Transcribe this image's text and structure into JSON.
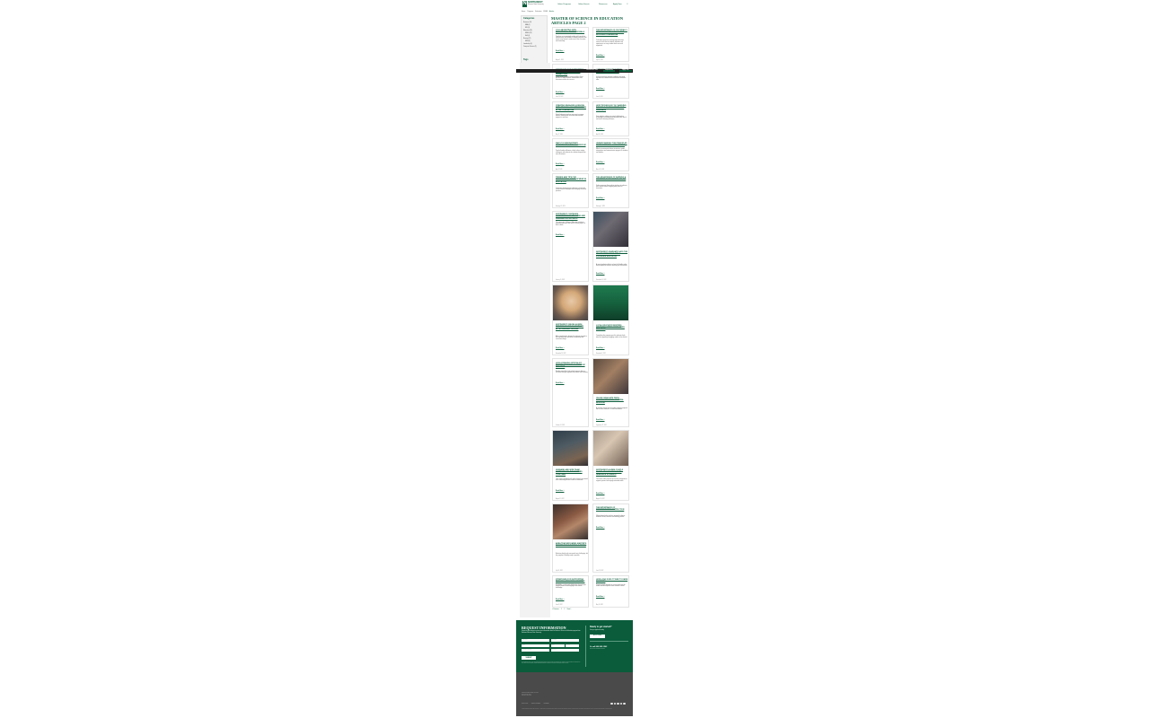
{
  "header": {
    "logo_mark": "N",
    "logo_name": "NORTHWEST",
    "logo_sub": "Missouri State University",
    "nav": [
      "Online Programs",
      "Online Events",
      "Resources",
      "Apply Now"
    ],
    "search_icon": "search-icon"
  },
  "breadcrumb": [
    "Home",
    "Programs",
    "Education",
    "MSED",
    "Articles"
  ],
  "sidebar": {
    "title": "Categories",
    "items": [
      "Business (10)",
      "MBA (5)",
      "MIS (3)",
      "Education (26)",
      "MSED (18)",
      "EdS (4)",
      "Nursing (12)",
      "MSN (8)",
      "Leadership (6)",
      "Computer Science (3)"
    ],
    "tags_title": "Tags"
  },
  "page_title": "Master of Science in Education Articles Page 2",
  "sticky": {
    "phone": "Call 660-562-1562",
    "request": "Request Info",
    "apply": "Apply Now"
  },
  "articles": [
    {
      "title": "Collaborating with Educational Professionals",
      "excerpt": "Teachers are increasingly working with specialists, administrators and families to design instruction that meets every learner's needs across the classroom and community.",
      "more": "Read More »",
      "date": "August 3, 2023"
    },
    {
      "title": "The Importance of Culturally Responsive Teaching in the Inclusive Classroom",
      "excerpt": "Culturally responsive teaching helps educators connect curriculum to students' identities and experiences so every student feels seen and supported.",
      "more": "Read More »",
      "date": "July 19, 2023"
    },
    {
      "title": "Strategies for Supporting Students With Learning Disabilities",
      "excerpt": "Understanding diverse learning profiles allows teachers to adapt lessons, assessments and classroom routines for success.",
      "more": "Read More »",
      "date": "June 28, 2023"
    },
    {
      "title": "How Inclusive Education Benefits All Learners",
      "excerpt": "Inclusive practices improve academic and social outcomes for students with and without disabilities alike.",
      "more": "Read More »",
      "date": "June 8, 2023"
    },
    {
      "title": "Creating Engaging Lessons With Technology Integration in the Classroom",
      "excerpt": "Digital tools give teachers new ways to engage learners, differentiate instruction and measure progress in real time.",
      "more": "Read More »",
      "date": "May 17, 2023"
    },
    {
      "title": "How Technology Is Changing the Role of Educators and Learners",
      "excerpt": "From adaptive software to virtual collaboration, technology is reshaping how educators plan, teach and assess learning outcomes.",
      "more": "Read More »",
      "date": "April 26, 2023"
    },
    {
      "title": "Ways to Demonstrate Leadership in the Classroom",
      "excerpt": "Teacher leaders influence school culture, mentor colleagues and advocate for students beyond their own classrooms.",
      "more": "Read More »",
      "date": "April 5, 2023"
    },
    {
      "title": "Understanding the Principles of Educational Assessment",
      "excerpt": "Effective assessment informs instruction, guides interventions and communicates progress to students and families.",
      "more": "Read More »",
      "date": "March 15, 2023"
    },
    {
      "title": "Trends and Tips for Professional Development in Education",
      "excerpt": "Continuous learning keeps educators current with research-based strategies and emerging classroom practices.",
      "more": "Read More »",
      "date": "February 22, 2023"
    },
    {
      "title": "The Advantages of Earning a Master's in Education Online",
      "excerpt": "Online programs allow working teachers to advance their careers without stepping away from the classroom.",
      "more": "Read More »",
      "date": "February 1, 2023"
    },
    {
      "title": "Northwest Continues Commitment to Teaching and Learning Excellence",
      "excerpt": "The university's College of Education continues preparing educators who make a lasting impact in their schools.",
      "more": "Read More »",
      "date": "January 11, 2023"
    },
    {
      "title": "Northwest Graduate Says the Online MSED Made Her a Stronger Educator",
      "excerpt": "A recent graduate reflects on how the flexible online format helped her balance teaching and coursework.",
      "more": "Read More »",
      "date": "December 14, 2022"
    },
    {
      "title": "Northwest Online Alumni Returns to the Classroom After Earning Degree",
      "excerpt": "After completing her degree, this alumna returned to the classroom with new skills in leadership and curriculum design.",
      "more": "Read More »",
      "date": "November 23, 2022"
    },
    {
      "title": "Local Educator Inspires Students After Completing Program",
      "excerpt": "Completing the program gave this educator fresh ideas for supporting struggling readers in her district.",
      "more": "Read More »",
      "date": "November 2, 2022"
    },
    {
      "title": "How a Reading Specialist Degree Changes Classroom Practice",
      "excerpt": "Reading specialists help schools improve literacy outcomes through targeted intervention and coaching.",
      "more": "Read More »",
      "date": "October 12, 2022"
    },
    {
      "title": "Online Graduate Finds Success Teaching in Rural Missouri",
      "excerpt": "A graduate shares how the online program prepared her to serve students in a small rural district.",
      "more": "Read More »",
      "date": "September 21, 2022"
    },
    {
      "title": "Husband and Wife Team Complete Online Degrees Together",
      "excerpt": "This couple supported each other through coursework while continuing full-time careers in education.",
      "more": "Read More »",
      "date": "August 31, 2022"
    },
    {
      "title": "Northwest Alumni Couple Share Advice for Future Graduate Students",
      "excerpt": "Two alumni offer practical tips on time management, support systems and staying motivated online.",
      "more": "Read More »",
      "date": "August 10, 2022"
    },
    {
      "title": "Area Teacher Earns Master's Degree While Raising a Family",
      "excerpt": "Balancing family and coursework was challenging, but the program's flexibility made it possible.",
      "more": "Read More »",
      "date": "July 20, 2022"
    },
    {
      "title": "The Importance of Differentiated Instruction",
      "excerpt": "Differentiation helps teachers respond to diverse readiness levels, interests and learning profiles.",
      "more": "Read More »",
      "date": "June 29, 2022"
    },
    {
      "title": "Strategies for Supporting English Language Learners",
      "excerpt": "Scaffolding, visuals and collaborative learning help English learners build language and content knowledge.",
      "more": "Read More »",
      "date": "June 8, 2022"
    },
    {
      "title": "How Long Does It Take to Earn an MSED?",
      "excerpt": "Program length depends on course load, transfer credits and the emphasis area students choose.",
      "more": "Read More »",
      "date": "May 18, 2022"
    }
  ],
  "pager": {
    "prev": "« Previous",
    "pages": [
      "1",
      "2"
    ],
    "next": "Next »"
  },
  "request": {
    "title": "REQUEST INFORMATION",
    "subtitle": "Submit the form below to receive more information about the Master of Science in Education program from Northwest Missouri State University.",
    "fields": [
      "First Name",
      "Last Name",
      "Email",
      "Phone",
      "Zip Code",
      "Program of Interest",
      "Start Term"
    ],
    "submit": "SUBMIT",
    "disclaimer": "By submitting this form, I agree that Northwest Missouri State University and its representatives may contact me about educational opportunities via email, phone or text message, including automated technology. Consent is not required to purchase goods or services."
  },
  "ready": {
    "title": "Ready to get started?",
    "subtitle": "Start your application today.",
    "apply": "APPLY NOW",
    "call": "Or call 660-562-1562",
    "call_sub": "Talk with an admissions advisor."
  },
  "footer": {
    "address": [
      "Northwest Missouri State University",
      "800 University Drive",
      "Maryville, MO 64468"
    ],
    "links": [
      "Privacy Policy",
      "Terms & Conditions",
      "Accessibility"
    ],
    "social": [
      "facebook-icon",
      "twitter-icon",
      "instagram-icon",
      "linkedin-icon",
      "youtube-icon"
    ],
    "copyright": "© 2023 Northwest Missouri State University. All rights reserved. Northwest Missouri State University has engaged Everspring, a leading provider of education and technology services, to support select aspects of program delivery."
  },
  "colors": {
    "brand": "#0a5c3b",
    "footer": "#4a4a4a",
    "sticky": "#1e1e1e"
  }
}
